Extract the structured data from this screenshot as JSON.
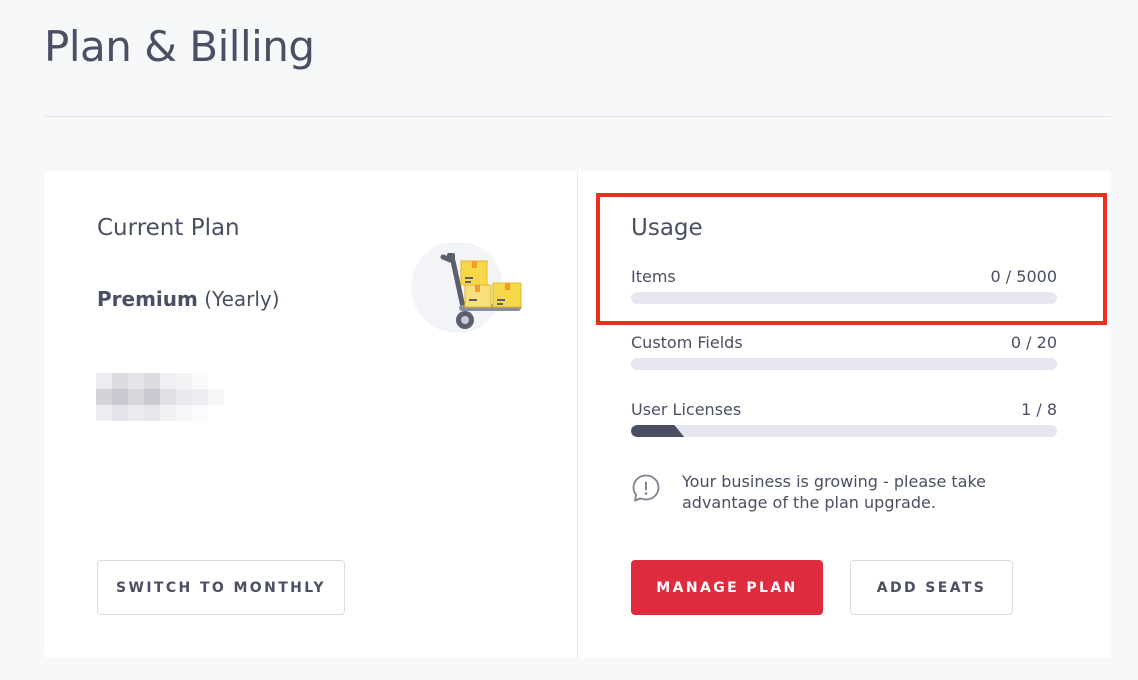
{
  "page": {
    "title": "Plan & Billing"
  },
  "current_plan": {
    "heading": "Current Plan",
    "plan_name": "Premium",
    "billing_period": "(Yearly)",
    "switch_button": "SWITCH TO MONTHLY"
  },
  "usage": {
    "heading": "Usage",
    "rows": [
      {
        "label": "Items",
        "value": "0 / 5000",
        "used": 0,
        "limit": 5000
      },
      {
        "label": "Custom Fields",
        "value": "0 / 20",
        "used": 0,
        "limit": 20
      },
      {
        "label": "User Licenses",
        "value": "1 / 8",
        "used": 1,
        "limit": 8
      }
    ],
    "notice": "Your business is growing - please take advantage of the plan upgrade.",
    "manage_button": "MANAGE PLAN",
    "seats_button": "ADD SEATS"
  },
  "colors": {
    "primary": "#de2b3e",
    "text": "#4a4f63",
    "track": "#e6e6f0",
    "highlight": "#ee2e1f"
  },
  "icons": {
    "illustration": "hand-truck-boxes-icon",
    "notice": "alert-speech-bubble-icon"
  }
}
